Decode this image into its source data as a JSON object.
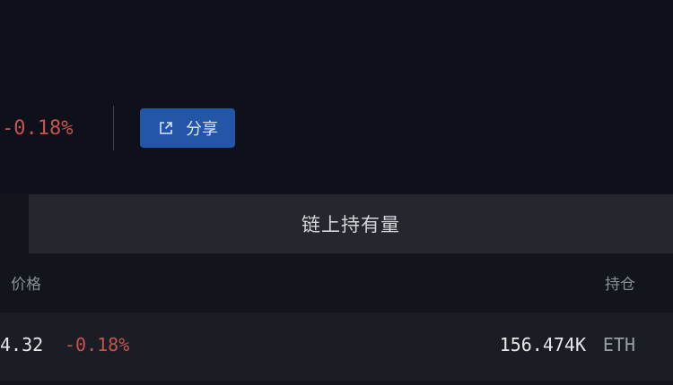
{
  "header": {
    "change_percent": "-0.18%",
    "share_label": "分享",
    "share_icon": "external-share-icon"
  },
  "tabs": {
    "active_label": "链上持有量"
  },
  "table": {
    "columns": {
      "price": "价格",
      "holding": "持仓"
    },
    "rows": [
      {
        "price": "4.32",
        "change": "-0.18%",
        "holding": "156.474K",
        "unit": "ETH"
      }
    ]
  },
  "colors": {
    "negative": "#c8524f",
    "accent": "#2456a8",
    "background": "#12151c"
  }
}
